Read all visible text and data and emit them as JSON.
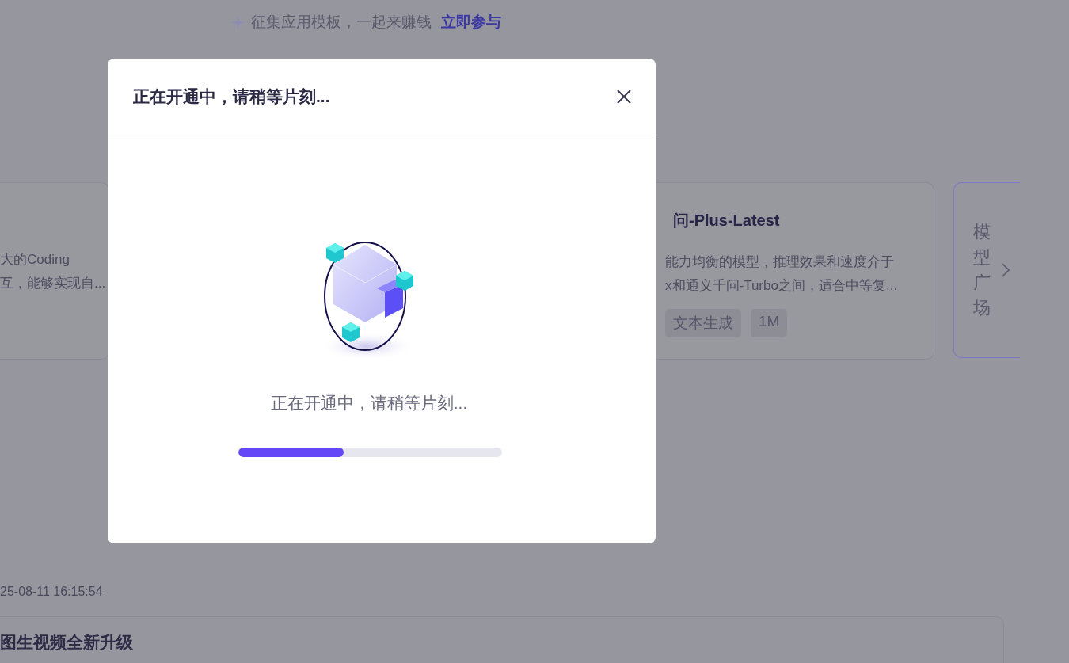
{
  "banner": {
    "text": "征集应用模板，一起来赚钱",
    "link": "立即参与"
  },
  "cards": [
    {
      "lines": [
        "大的Coding",
        "互，能够实现自..."
      ]
    },
    {
      "title": "问-Plus-Latest",
      "lines": [
        "能力均衡的模型，推理效果和速度介于",
        "x和通义千问-Turbo之间，适合中等复..."
      ],
      "tags": [
        "文本生成",
        "1M"
      ]
    }
  ],
  "plaza": {
    "label": "模型广场"
  },
  "timestamp": "25-08-11 16:15:54",
  "news": {
    "title": "图生视频全新升级"
  },
  "dialog": {
    "title": "正在开通中，请稍等片刻...",
    "message": "正在开通中，请稍等片刻...",
    "progress": {
      "level": 0.4
    }
  }
}
